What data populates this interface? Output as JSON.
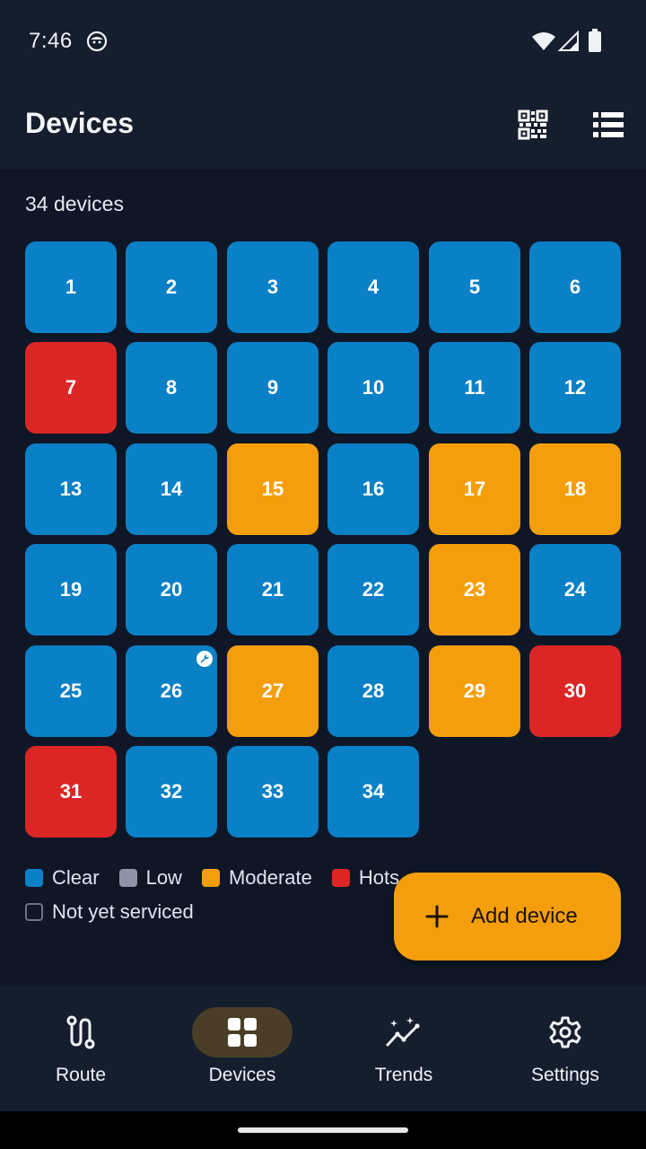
{
  "status_bar": {
    "time": "7:46",
    "icons": [
      "face-notification-icon",
      "wifi-icon",
      "signal-icon",
      "battery-icon"
    ]
  },
  "app_bar": {
    "title": "Devices",
    "actions": [
      "qr-code-icon",
      "list-view-icon"
    ]
  },
  "device_count": "34 devices",
  "colors": {
    "clear": "#0a80c6",
    "low": "#8c94a6",
    "moderate": "#f59e0b",
    "hotspot": "#dc2626",
    "not_serviced": "#6b7484"
  },
  "devices": [
    {
      "label": "1",
      "status": "clear"
    },
    {
      "label": "2",
      "status": "clear"
    },
    {
      "label": "3",
      "status": "clear"
    },
    {
      "label": "4",
      "status": "clear"
    },
    {
      "label": "5",
      "status": "clear"
    },
    {
      "label": "6",
      "status": "clear"
    },
    {
      "label": "7",
      "status": "hotspot"
    },
    {
      "label": "8",
      "status": "clear"
    },
    {
      "label": "9",
      "status": "clear"
    },
    {
      "label": "10",
      "status": "clear"
    },
    {
      "label": "11",
      "status": "clear"
    },
    {
      "label": "12",
      "status": "clear"
    },
    {
      "label": "13",
      "status": "clear"
    },
    {
      "label": "14",
      "status": "clear"
    },
    {
      "label": "15",
      "status": "moderate"
    },
    {
      "label": "16",
      "status": "clear"
    },
    {
      "label": "17",
      "status": "moderate"
    },
    {
      "label": "18",
      "status": "moderate"
    },
    {
      "label": "19",
      "status": "clear"
    },
    {
      "label": "20",
      "status": "clear"
    },
    {
      "label": "21",
      "status": "clear"
    },
    {
      "label": "22",
      "status": "clear"
    },
    {
      "label": "23",
      "status": "moderate"
    },
    {
      "label": "24",
      "status": "clear"
    },
    {
      "label": "25",
      "status": "clear"
    },
    {
      "label": "26",
      "status": "clear",
      "badge": "wrench-icon"
    },
    {
      "label": "27",
      "status": "moderate"
    },
    {
      "label": "28",
      "status": "clear"
    },
    {
      "label": "29",
      "status": "moderate"
    },
    {
      "label": "30",
      "status": "hotspot"
    },
    {
      "label": "31",
      "status": "hotspot"
    },
    {
      "label": "32",
      "status": "clear"
    },
    {
      "label": "33",
      "status": "clear"
    },
    {
      "label": "34",
      "status": "clear"
    }
  ],
  "legend": {
    "clear": "Clear",
    "low": "Low",
    "moderate": "Moderate",
    "hotspot": "Hots",
    "not_serviced": "Not yet serviced"
  },
  "fab": {
    "label": "Add device",
    "icon": "plus-icon"
  },
  "nav": [
    {
      "label": "Route",
      "icon": "route-icon",
      "active": false
    },
    {
      "label": "Devices",
      "icon": "grid-icon",
      "active": true
    },
    {
      "label": "Trends",
      "icon": "trends-icon",
      "active": false
    },
    {
      "label": "Settings",
      "icon": "gear-icon",
      "active": false
    }
  ]
}
